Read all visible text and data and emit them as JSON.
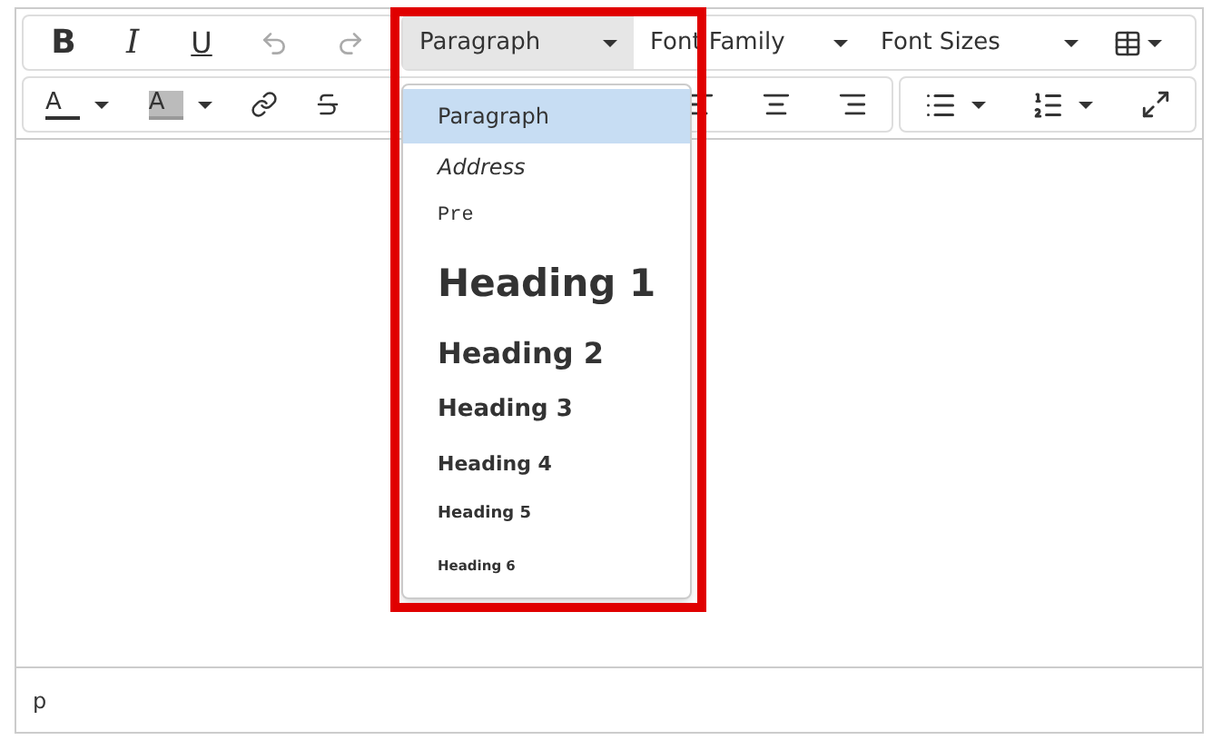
{
  "toolbar": {
    "format_buttons": [
      "B",
      "I",
      "U"
    ],
    "dropdowns": [
      {
        "label": "Paragraph",
        "open": true
      },
      {
        "label": "Font Family",
        "open": false
      },
      {
        "label": "Font Sizes",
        "open": false
      }
    ],
    "text_color_glyph": "A",
    "background_color_glyph": "A"
  },
  "format_menu": [
    {
      "label": "Paragraph",
      "kind": "p",
      "selected": true
    },
    {
      "label": "Address",
      "kind": "address",
      "selected": false
    },
    {
      "label": "Pre",
      "kind": "pre",
      "selected": false
    },
    {
      "label": "Heading 1",
      "kind": "h1",
      "selected": false
    },
    {
      "label": "Heading 2",
      "kind": "h2",
      "selected": false
    },
    {
      "label": "Heading 3",
      "kind": "h3",
      "selected": false
    },
    {
      "label": "Heading 4",
      "kind": "h4",
      "selected": false
    },
    {
      "label": "Heading 5",
      "kind": "h5",
      "selected": false
    },
    {
      "label": "Heading 6",
      "kind": "h6",
      "selected": false
    }
  ],
  "status_bar": {
    "path": "p"
  }
}
